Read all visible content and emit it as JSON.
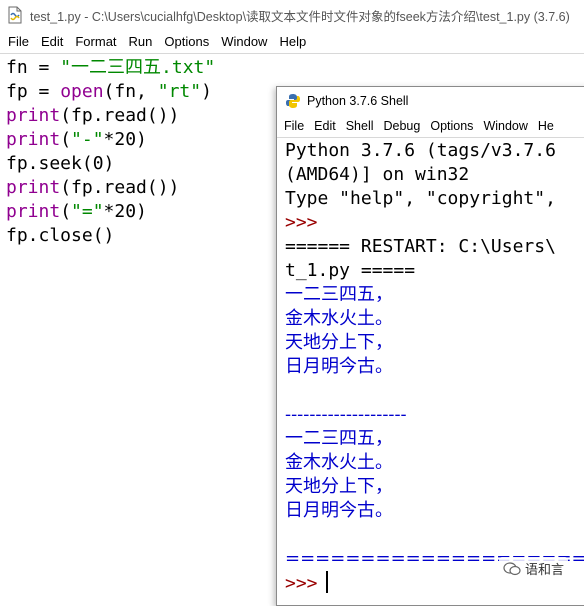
{
  "editor": {
    "title": "test_1.py - C:\\Users\\cucialhfg\\Desktop\\读取文本文件时文件对象的fseek方法介绍\\test_1.py (3.7.6)",
    "menu": [
      "File",
      "Edit",
      "Format",
      "Run",
      "Options",
      "Window",
      "Help"
    ],
    "code": {
      "l1_var": "fn = ",
      "l1_str": "\"一二三四五.txt\"",
      "l2_var": "fp = ",
      "l2_kw": "open",
      "l2_rest": "(fn, ",
      "l2_str": "\"rt\"",
      "l2_end": ")",
      "l3_kw": "print",
      "l3_rest": "(fp.read())",
      "l4_kw": "print",
      "l4_open": "(",
      "l4_str": "\"-\"",
      "l4_rest": "*20)",
      "l5": "fp.seek(0)",
      "l6_kw": "print",
      "l6_rest": "(fp.read())",
      "l7_kw": "print",
      "l7_open": "(",
      "l7_str": "\"=\"",
      "l7_rest": "*20)",
      "l8": "fp.close()"
    }
  },
  "shell": {
    "title": "Python 3.7.6 Shell",
    "menu": [
      "File",
      "Edit",
      "Shell",
      "Debug",
      "Options",
      "Window",
      "He"
    ],
    "output": {
      "banner1": "Python 3.7.6 (tags/v3.7.6",
      "banner2": "(AMD64)] on win32",
      "banner3": "Type \"help\", \"copyright\",",
      "prompt": ">>>",
      "restart1": "====== RESTART: C:\\Users\\",
      "restart2": "t_1.py =====",
      "r1": [
        "一二三四五，",
        "金木水火土。",
        "天地分上下，",
        "日月明今古。"
      ],
      "sep_dash": "--------------------",
      "r2": [
        "一二三四五，",
        "金木水火土。",
        "天地分上下，",
        "日月明今古。"
      ],
      "sep_eq": "====================",
      "final_prompt": ">>>"
    }
  },
  "watermark": {
    "text": "语和言"
  },
  "colors": {
    "keyword": "#900090",
    "string": "#008800",
    "prompt": "#990000",
    "stdout": "#0000cc"
  }
}
